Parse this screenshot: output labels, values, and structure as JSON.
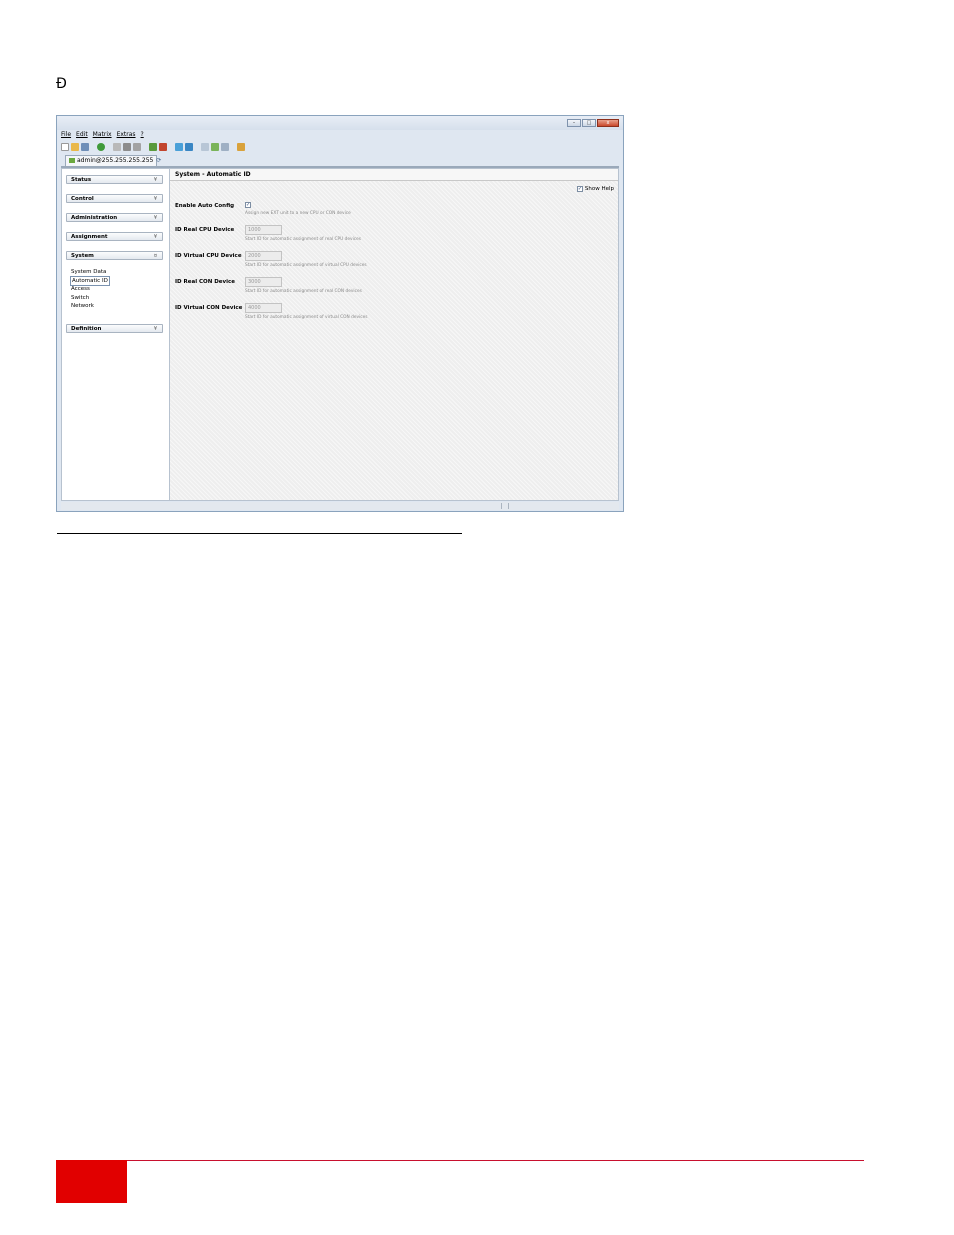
{
  "doc": {
    "arrow_glyph": "Ð"
  },
  "window": {
    "controls": {
      "minimize": "–",
      "maximize": "□",
      "close": "x"
    },
    "menu": [
      "File",
      "Edit",
      "Matrix",
      "Extras",
      "?"
    ],
    "toolbar_icons": [
      "new-icon",
      "open-icon",
      "save-icon",
      "refresh-icon",
      "delete-icon",
      "copy-icon",
      "paste-icon",
      "connect-icon",
      "disconnect-icon",
      "upload-icon",
      "download-icon",
      "document-icon",
      "export-icon",
      "print-icon",
      "book-icon"
    ],
    "tab": {
      "label": "admin@255.255.255.255",
      "refresh_glyph": "⟳"
    }
  },
  "sidebar": {
    "sections": [
      {
        "label": "Status",
        "chevron": "¥"
      },
      {
        "label": "Control",
        "chevron": "¥"
      },
      {
        "label": "Administration",
        "chevron": "¥"
      },
      {
        "label": "Assignment",
        "chevron": "¥"
      },
      {
        "label": "System",
        "chevron": "¤"
      },
      {
        "label": "Definition",
        "chevron": "¥"
      }
    ],
    "system_items": [
      "System Data",
      "Automatic ID",
      "Access",
      "Switch",
      "Network"
    ]
  },
  "panel": {
    "title": "System - Automatic ID",
    "show_help": {
      "label": "Show Help",
      "checked": true
    },
    "fields": [
      {
        "label": "Enable Auto Config",
        "type": "checkbox",
        "checked": true,
        "help": "Assign new EXT unit to a new CPU or CON device"
      },
      {
        "label": "ID Real CPU Device",
        "value": "1000",
        "help": "Start ID for automatic assignment of real CPU devices"
      },
      {
        "label": "ID Virtual CPU Device",
        "value": "2000",
        "help": "Start ID for automatic assignment of virtual CPU devices"
      },
      {
        "label": "ID Real CON Device",
        "value": "3000",
        "help": "Start ID for automatic assignment of real CON devices"
      },
      {
        "label": "ID Virtual CON Device",
        "value": "4000",
        "help": "Start ID for automatic assignment of virtual CON devices"
      }
    ]
  },
  "colors": {
    "accent_red": "#e10000",
    "footer_line": "#c8102e"
  }
}
